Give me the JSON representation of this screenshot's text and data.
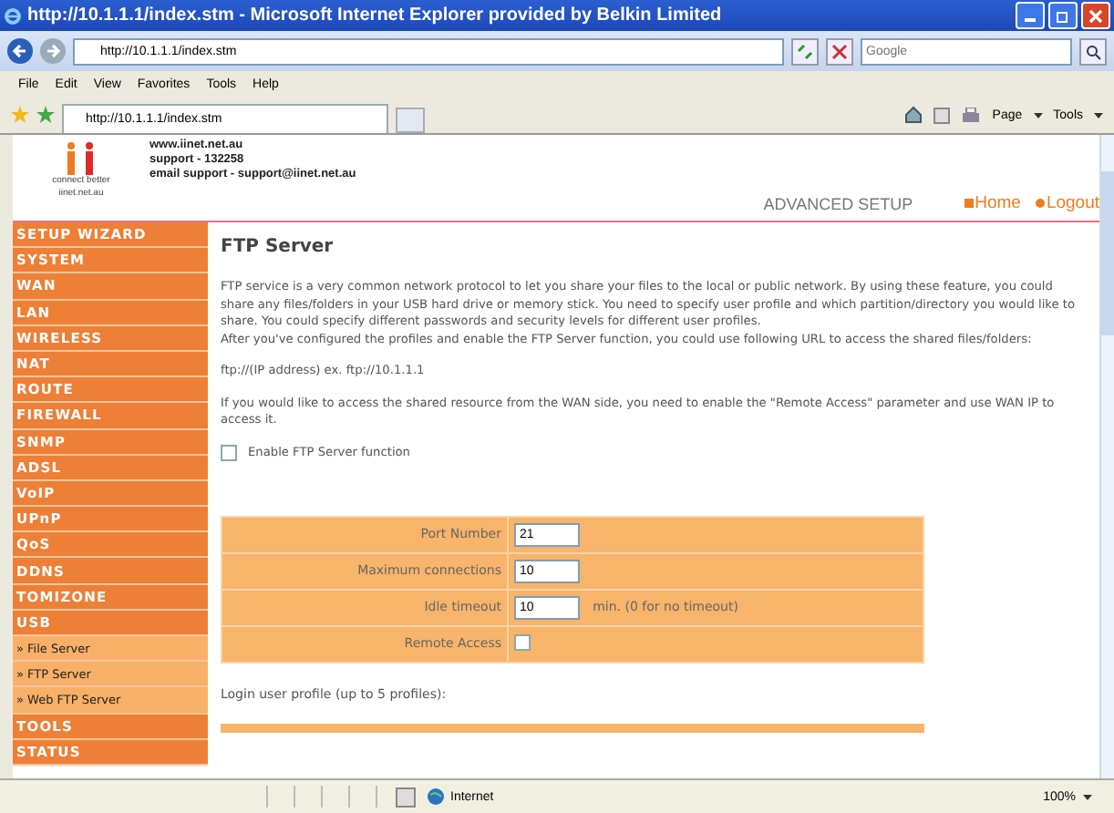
{
  "window": {
    "title": "http://10.1.1.1/index.stm - Microsoft Internet Explorer provided by Belkin Limited"
  },
  "address_bar": {
    "value": "http://10.1.1.1/index.stm"
  },
  "search": {
    "placeholder": "Google"
  },
  "menu": [
    "File",
    "Edit",
    "View",
    "Favorites",
    "Tools",
    "Help"
  ],
  "tabs": [
    {
      "label": "http://10.1.1.1/index.stm",
      "selected": true
    }
  ],
  "command_bar": {
    "page": "Page",
    "tools": "Tools"
  },
  "header": {
    "logo_tagline": "connect better",
    "logo_site": "iinet.net.au",
    "info": [
      "www.iinet.net.au",
      "support - 132258",
      "email support - support@iinet.net.au"
    ],
    "section": "ADVANCED SETUP",
    "links": [
      "Home",
      "Logout"
    ]
  },
  "sidebar": {
    "items": [
      {
        "label": "SETUP WIZARD",
        "kind": "main",
        "selected": false
      },
      {
        "label": "SYSTEM",
        "kind": "main",
        "selected": false
      },
      {
        "label": "WAN",
        "kind": "main",
        "selected": false
      },
      {
        "label": "LAN",
        "kind": "main",
        "selected": false
      },
      {
        "label": "WIRELESS",
        "kind": "main",
        "selected": false
      },
      {
        "label": "NAT",
        "kind": "main",
        "selected": false
      },
      {
        "label": "ROUTE",
        "kind": "main",
        "selected": false
      },
      {
        "label": "FIREWALL",
        "kind": "main",
        "selected": false
      },
      {
        "label": "SNMP",
        "kind": "main",
        "selected": false
      },
      {
        "label": "ADSL",
        "kind": "main",
        "selected": false
      },
      {
        "label": "VoIP",
        "kind": "main",
        "selected": false
      },
      {
        "label": "UPnP",
        "kind": "main",
        "selected": false
      },
      {
        "label": "QoS",
        "kind": "main",
        "selected": false
      },
      {
        "label": "DDNS",
        "kind": "main",
        "selected": false
      },
      {
        "label": "TOMIZONE",
        "kind": "main",
        "selected": false
      },
      {
        "label": "USB",
        "kind": "main",
        "selected": false
      },
      {
        "label": "» File Server",
        "kind": "sub",
        "selected": false
      },
      {
        "label": "» FTP Server",
        "kind": "sub",
        "selected": false
      },
      {
        "label": "» Web FTP Server",
        "kind": "sub",
        "selected": false
      },
      {
        "label": "TOOLS",
        "kind": "main",
        "selected": false
      },
      {
        "label": "STATUS",
        "kind": "main",
        "selected": false
      }
    ]
  },
  "content": {
    "title": "FTP Server",
    "paragraphs": [
      "FTP service is a very common network protocol to let you share your files to the local or public network. By using these feature, you could share any files/folders in your USB hard drive or memory stick. You need to specify user profile and which partition/directory you would like to share. You could specify different passwords and security levels for different user profiles.\nAfter you've configured the profiles and enable the FTP Server function, you could use following URL to access the shared files/folders:",
      "ftp://(IP address)  ex. ftp://10.1.1.1",
      "If you would like to access the shared resource from the WAN side, you need to enable the \"Remote Access\" parameter and use WAN IP to access it."
    ],
    "enable": {
      "label": "Enable FTP Server function",
      "checked": false
    },
    "settings": [
      {
        "label": "Port Number",
        "kind": "input",
        "value": "21"
      },
      {
        "label": "Maximum connections",
        "kind": "input",
        "value": "10"
      },
      {
        "label": "Idle timeout",
        "kind": "input",
        "value": "10",
        "note": "min. (0 for no timeout)"
      },
      {
        "label": "Remote Access",
        "kind": "checkbox",
        "checked": false
      }
    ],
    "profiles_label": "Login user profile (up to 5 profiles):"
  },
  "status_bar": {
    "zone": "Internet",
    "zoom": "100%"
  }
}
